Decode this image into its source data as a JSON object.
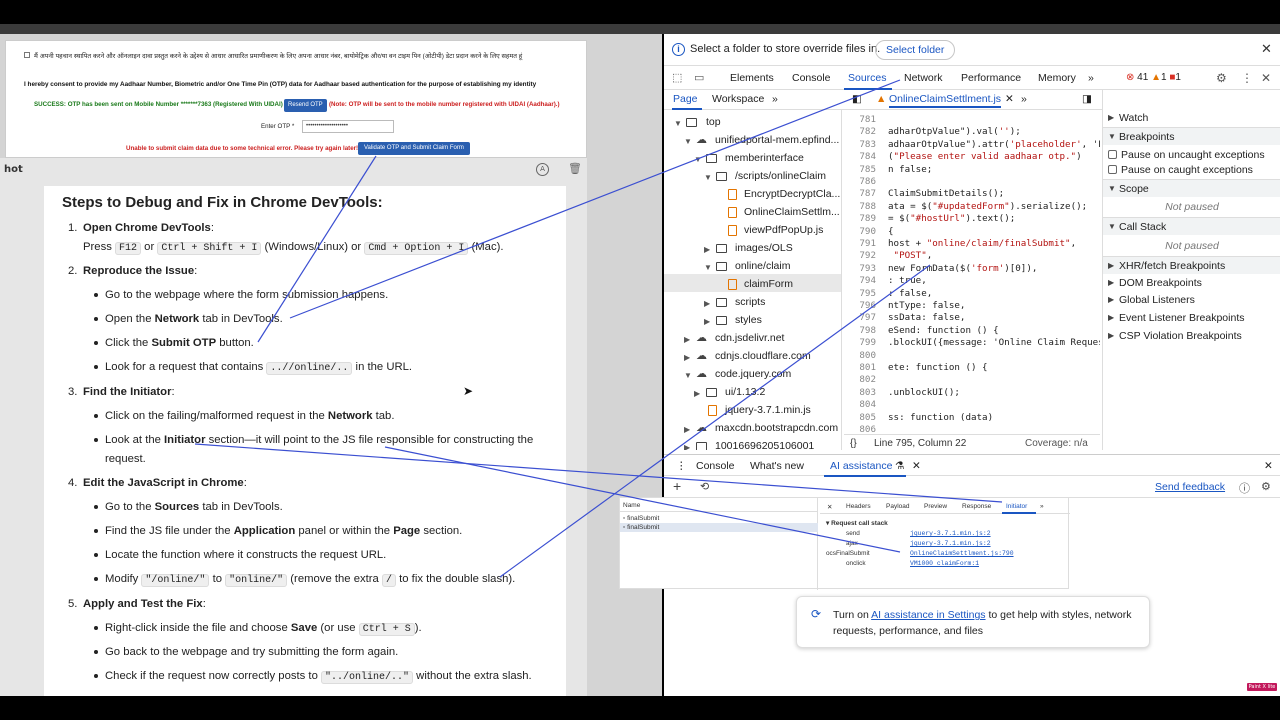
{
  "form": {
    "hindi_consent": "मैं अपनी पहचान स्थापित करने और ऑनलाइन दावा प्रस्तुत करने के उद्देश्य से आधार आधारित प्रमाणीकरण के लिए अपना आधार नंबर, बायोमेट्रिक और/या वन टाइम पिन (ओटीपी) डेटा प्रदान करने के लिए सहमत हूं",
    "english_consent": "I hereby consent to provide my Aadhaar Number, Biometric and/or One Time Pin (OTP) data for Aadhaar based authentication for the purpose of establishing my identity",
    "success_msg": "SUCCESS: OTP has been sent on Mobile Number *******7363 (Registered With UIDAI)",
    "resend_label": "Resend OTP",
    "note": "(Note: OTP will be sent to the mobile number registered with UIDAI (Aadhaar).)",
    "otp_label": "Enter OTP *",
    "otp_value": "••••••••••••••••••••",
    "error_msg": "Unable to submit claim data due to some technical error. Please try again later!",
    "submit_label": "Validate OTP and Submit Claim Form"
  },
  "chat": {
    "snapshot_label": "hot",
    "title": "Steps to Debug and Fix in Chrome DevTools:",
    "s1_num": "1.",
    "s1_head": "Open Chrome DevTools",
    "s1_l1a": "Press ",
    "s1_k1": "F12",
    "s1_l1b": " or ",
    "s1_k2": "Ctrl + Shift + I",
    "s1_l1c": " (Windows/Linux) or ",
    "s1_k3": "Cmd + Option + I",
    "s1_l1d": " (Mac).",
    "s2_num": "2.",
    "s2_head": "Reproduce the Issue",
    "s2_b1": "Go to the webpage where the form submission happens.",
    "s2_b2a": "Open the ",
    "s2_b2b": "Network",
    "s2_b2c": " tab in DevTools.",
    "s2_b3a": "Click the ",
    "s2_b3b": "Submit OTP",
    "s2_b3c": " button.",
    "s2_b4a": "Look for a request that contains ",
    "s2_b4code": "..//online/..",
    "s2_b4c": " in the URL.",
    "s3_num": "3.",
    "s3_head": "Find the Initiator",
    "s3_b1a": "Click on the failing/malformed request in the ",
    "s3_b1b": "Network",
    "s3_b1c": " tab.",
    "s3_b2a": "Look at the ",
    "s3_b2b": "Initiator",
    "s3_b2c": " section—it will point to the JS file responsible for constructing the",
    "s3_b2d": "request.",
    "s4_num": "4.",
    "s4_head": "Edit the JavaScript in Chrome",
    "s4_b1a": "Go to the ",
    "s4_b1b": "Sources",
    "s4_b1c": " tab in DevTools.",
    "s4_b2a": "Find the JS file under the ",
    "s4_b2b": "Application",
    "s4_b2c": " panel or within the ",
    "s4_b2d": "Page",
    "s4_b2e": " section.",
    "s4_b3": "Locate the function where it constructs the request URL.",
    "s4_b4a": "Modify ",
    "s4_b4c1": "\"/online/\"",
    "s4_b4b": " to ",
    "s4_b4c2": "\"online/\"",
    "s4_b4c": " (remove the extra ",
    "s4_b4c3": "/",
    "s4_b4d": " to fix the double slash).",
    "s5_num": "5.",
    "s5_head": "Apply and Test the Fix",
    "s5_b1a": "Right-click inside the file and choose ",
    "s5_b1b": "Save",
    "s5_b1c": " (or use ",
    "s5_b1code": "Ctrl + S",
    "s5_b1d": ").",
    "s5_b2": "Go back to the webpage and try submitting the form again.",
    "s5_b3a": "Check if the request now correctly posts to ",
    "s5_b3code": "\"../online/..\"",
    "s5_b3c": " without the extra slash.",
    "colon": ":"
  },
  "devtools": {
    "info_text": "Select a folder to store override files in.",
    "select_folder": "Select folder",
    "tabs": [
      "Elements",
      "Console",
      "Sources",
      "Network",
      "Performance",
      "Memory"
    ],
    "err_count": "41",
    "warn_count": "1",
    "issue_count": "1",
    "subtabs": [
      "Page",
      "Workspace"
    ],
    "file_tab": "OnlineClaimSettlment.js",
    "tree": {
      "top": "top",
      "portal": "unifiedportal-mem.epfind...",
      "memberinterface": "memberinterface",
      "scripts_online": "/scripts/onlineClaim",
      "f1": "EncryptDecryptCla...",
      "f2": "OnlineClaimSettlm...",
      "f3": "viewPdfPopUp.js",
      "images": "images/OLS",
      "online_claim": "online/claim",
      "claimform": "claimForm",
      "scripts": "scripts",
      "styles": "styles",
      "cdn1": "cdn.jsdelivr.net",
      "cdn2": "cdnjs.cloudflare.com",
      "cdn3": "code.jquery.com",
      "ui": "ui/1.13.2",
      "jq": "jquery-3.7.1.min.js",
      "maxcdn": "maxcdn.bootstrapcdn.com",
      "id": "10016696205106001"
    },
    "code_lines": [
      {
        "n": "781",
        "t": ""
      },
      {
        "n": "782",
        "t": "adharOtpValue\").val('');"
      },
      {
        "n": "783",
        "t": "adhaarOtpValue\").attr('placeholder', 'Pl"
      },
      {
        "n": "784",
        "t": "(\"Please enter valid aadhaar otp.\")"
      },
      {
        "n": "785",
        "t": "n false;"
      },
      {
        "n": "786",
        "t": ""
      },
      {
        "n": "787",
        "t": "ClaimSubmitDetails();"
      },
      {
        "n": "788",
        "t": "ata = $(\"#updatedForm\").serialize();"
      },
      {
        "n": "789",
        "t": "= $(\"#hostUrl\").text();"
      },
      {
        "n": "790",
        "t": "{"
      },
      {
        "n": "791",
        "t": "host + \"online/claim/finalSubmit\","
      },
      {
        "n": "792",
        "t": " \"POST\","
      },
      {
        "n": "793",
        "t": "new FormData($('form')[0]),"
      },
      {
        "n": "794",
        "t": ": true,"
      },
      {
        "n": "795",
        "t": ": false,"
      },
      {
        "n": "796",
        "t": "ntType: false,"
      },
      {
        "n": "797",
        "t": "ssData: false,"
      },
      {
        "n": "798",
        "t": "eSend: function () {"
      },
      {
        "n": "799",
        "t": ".blockUI({message: 'Online Claim Request"
      },
      {
        "n": "800",
        "t": ""
      },
      {
        "n": "801",
        "t": "ete: function () {"
      },
      {
        "n": "802",
        "t": ""
      },
      {
        "n": "803",
        "t": ".unblockUI();"
      },
      {
        "n": "804",
        "t": ""
      },
      {
        "n": "805",
        "t": "ss: function (data)"
      },
      {
        "n": "806",
        "t": ""
      }
    ],
    "status_pos": "Line 795, Column 22",
    "coverage": "Coverage: n/a",
    "sidebar": {
      "watch": "Watch",
      "breakpoints": "Breakpoints",
      "pause_uncaught": "Pause on uncaught exceptions",
      "pause_caught": "Pause on caught exceptions",
      "scope": "Scope",
      "not_paused": "Not paused",
      "call_stack": "Call Stack",
      "xhr": "XHR/fetch Breakpoints",
      "dom": "DOM Breakpoints",
      "global": "Global Listeners",
      "event": "Event Listener Breakpoints",
      "csp": "CSP Violation Breakpoints"
    },
    "drawer_tabs": [
      "Console",
      "What's new",
      "AI assistance"
    ],
    "send_feedback": "Send feedback",
    "promo_a": "Turn on ",
    "promo_link": "AI assistance in Settings",
    "promo_b": " to get help with styles, network requests, performance, and files"
  },
  "netsnip": {
    "name_header": "Name",
    "rows": [
      "finalSubmit",
      "finalSubmit"
    ],
    "tabs": [
      "Headers",
      "Payload",
      "Preview",
      "Response",
      "Initiator"
    ],
    "callstack_title": "Request call stack",
    "stack": [
      {
        "fn": "send",
        "loc": "jquery-3.7.1.min.js:2"
      },
      {
        "fn": "ajax",
        "loc": "jquery-3.7.1.min.js:2"
      },
      {
        "fn": "ocsFinalSubmit",
        "loc": "OnlineClaimSettlment.js:790"
      },
      {
        "fn": "onclick",
        "loc": "VM1000 claimForm:1"
      }
    ]
  },
  "badge": "Paint X lite"
}
